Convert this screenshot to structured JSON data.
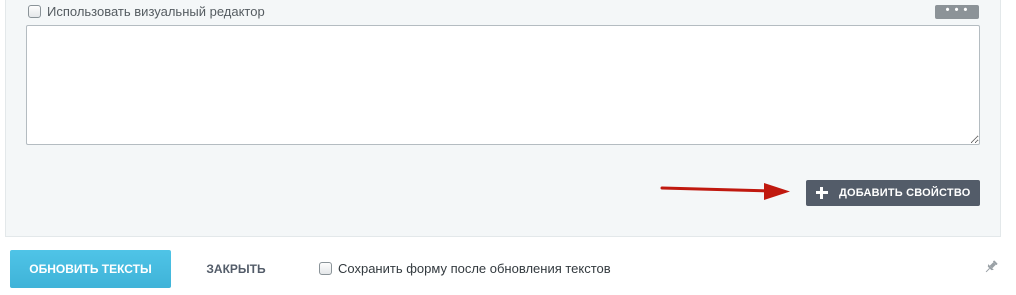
{
  "editor": {
    "visual_editor_label": "Использовать визуальный редактор",
    "visual_editor_checked": false,
    "more_label": "• • •",
    "text_value": ""
  },
  "actions": {
    "add_property_label": "Добавить свойство"
  },
  "footer": {
    "update_label": "Обновить тексты",
    "close_label": "Закрыть",
    "save_form_label": "Сохранить форму после обновления текстов",
    "save_form_checked": false
  },
  "colors": {
    "panel_background": "#f4f7f8",
    "add_button": "#535c69",
    "update_button": "#47bde2",
    "arrow": "#c0190f"
  },
  "icons": {
    "plus": "plus-icon",
    "pin": "pin-icon",
    "arrow": "arrow-right-icon"
  }
}
